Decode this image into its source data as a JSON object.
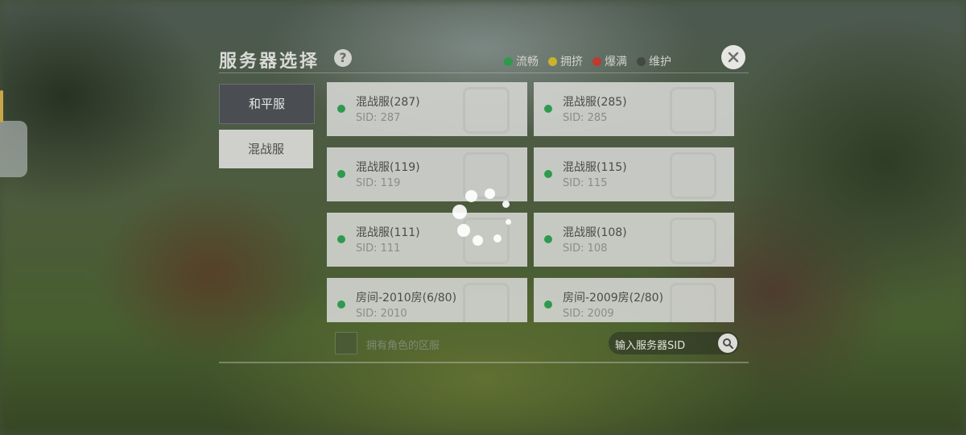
{
  "title": "服务器选择",
  "help_label": "?",
  "legend": [
    {
      "label": "流畅",
      "color": "#2f9a4c"
    },
    {
      "label": "拥挤",
      "color": "#c9b32a"
    },
    {
      "label": "爆满",
      "color": "#c03a30"
    },
    {
      "label": "维护",
      "color": "#444844"
    }
  ],
  "close_icon": "close-x-icon",
  "categories": [
    {
      "label": "和平服",
      "active": true
    },
    {
      "label": "混战服",
      "active": false
    }
  ],
  "servers": [
    {
      "name": "混战服(287)",
      "sid": "SID: 287",
      "status": "流畅"
    },
    {
      "name": "混战服(285)",
      "sid": "SID: 285",
      "status": "流畅"
    },
    {
      "name": "混战服(119)",
      "sid": "SID: 119",
      "status": "流畅"
    },
    {
      "name": "混战服(115)",
      "sid": "SID: 115",
      "status": "流畅"
    },
    {
      "name": "混战服(111)",
      "sid": "SID: 111",
      "status": "流畅"
    },
    {
      "name": "混战服(108)",
      "sid": "SID: 108",
      "status": "流畅"
    },
    {
      "name": "房间-2010房(6/80)",
      "sid": "SID: 2010",
      "status": "流畅"
    },
    {
      "name": "房间-2009房(2/80)",
      "sid": "SID: 2009",
      "status": "流畅"
    }
  ],
  "has_role_checkbox_label": "拥有角色的区服",
  "search_placeholder": "输入服务器SID",
  "search_icon": "search-icon",
  "loading_icon": "loading-spinner-icon"
}
